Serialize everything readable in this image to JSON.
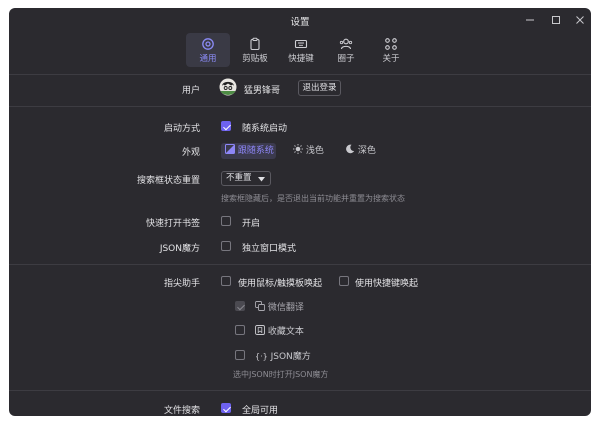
{
  "window": {
    "title": "设置"
  },
  "tabs": [
    {
      "label": "通用",
      "icon": "gear-icon",
      "active": true
    },
    {
      "label": "剪贴板",
      "icon": "clipboard-icon",
      "active": false
    },
    {
      "label": "快捷键",
      "icon": "keyboard-icon",
      "active": false
    },
    {
      "label": "圈子",
      "icon": "group-icon",
      "active": false
    },
    {
      "label": "关于",
      "icon": "link-icon",
      "active": false
    }
  ],
  "user": {
    "label": "用户",
    "name": "猛男锋哥",
    "logout": "退出登录"
  },
  "startup": {
    "label": "启动方式",
    "option": "随系统启动",
    "checked": true
  },
  "appearance": {
    "label": "外观",
    "options": [
      {
        "label": "跟随系统",
        "icon": "follow-system-icon",
        "active": true
      },
      {
        "label": "浅色",
        "icon": "sun-icon",
        "active": false
      },
      {
        "label": "深色",
        "icon": "moon-icon",
        "active": false
      }
    ]
  },
  "search_reset": {
    "label": "搜索框状态重置",
    "value": "不重置",
    "hint": "搜索框隐藏后，是否退出当前功能并重置为搜索状态"
  },
  "bookmarks": {
    "label": "快速打开书签",
    "option": "开启",
    "checked": false
  },
  "json_magic": {
    "label": "JSON魔方",
    "option": "独立窗口模式",
    "checked": false
  },
  "fingertip": {
    "label": "指尖助手",
    "mouse_option": "使用鼠标/触摸板唤起",
    "mouse_checked": false,
    "hotkey_option": "使用快捷键唤起",
    "hotkey_checked": false,
    "features": [
      {
        "label": "微信翻译",
        "icon": "translate-icon",
        "checked": true,
        "disabled": true
      },
      {
        "label": "收藏文本",
        "icon": "bookmark-icon",
        "checked": false,
        "disabled": false
      },
      {
        "label": "JSON魔方",
        "icon": "braces-icon",
        "checked": false,
        "disabled": false
      }
    ],
    "json_hint": "选中JSON时打开JSON魔方"
  },
  "file_search": {
    "label": "文件搜索",
    "option": "全局可用",
    "checked": true
  },
  "colors": {
    "accent": "#6e62f0",
    "background": "#2b2a2f",
    "text": "#d6d6d8"
  }
}
